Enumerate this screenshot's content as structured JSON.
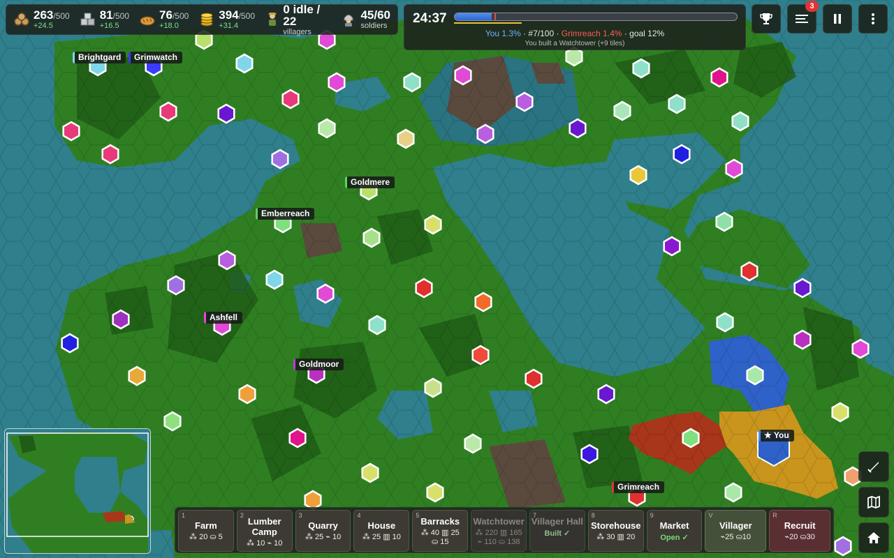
{
  "resources": [
    {
      "name": "wood",
      "icon": "logs-icon",
      "value": "263",
      "max": "/500",
      "rate": "+24.5"
    },
    {
      "name": "stone",
      "icon": "stone-blocks-icon",
      "value": "81",
      "max": "/500",
      "rate": "+16.5"
    },
    {
      "name": "food",
      "icon": "bread-icon",
      "value": "76",
      "max": "/500",
      "rate": "+18.0"
    },
    {
      "name": "gold",
      "icon": "coin-stack-icon",
      "value": "394",
      "max": "/500",
      "rate": "+31.4"
    }
  ],
  "villagers": {
    "value": "0 idle / 22",
    "label": "villagers"
  },
  "soldiers": {
    "value": "45/60",
    "label": "soldiers"
  },
  "timer": "24:37",
  "progress": {
    "you_fraction": 0.013,
    "rival_fraction": 0.014,
    "goal_fraction": 0.12
  },
  "standings": {
    "you": "You 1.3%",
    "rank": " · #7/100 · ",
    "rival": "Grimreach 1.4%",
    "goal": " · goal 12%"
  },
  "last_action": "You built a Watchtower (+9 tiles)",
  "notifications_count": "3",
  "cities": [
    {
      "name": "Brightgard",
      "color": "#7fd6e8"
    },
    {
      "name": "Grimwatch",
      "color": "#3b3bff"
    },
    {
      "name": "Goldmere",
      "color": "#57d957"
    },
    {
      "name": "Emberreach",
      "color": "#5fd15f"
    },
    {
      "name": "Ashfell",
      "color": "#e04ad6"
    },
    {
      "name": "Goldmoor",
      "color": "#b93ed0"
    },
    {
      "name": "Grimreach",
      "color": "#e23434"
    },
    {
      "name": "★ You",
      "color": "#4a8ef0"
    }
  ],
  "build": [
    {
      "key": "1",
      "name": "Farm",
      "cost": "⁂ 20 ⛀ 5"
    },
    {
      "key": "2",
      "name": "Lumber Camp",
      "cost": "⁂ 10 ⌁ 10"
    },
    {
      "key": "3",
      "name": "Quarry",
      "cost": "⁂ 25 ⌁ 10"
    },
    {
      "key": "4",
      "name": "House",
      "cost": "⁂ 25 ▥ 10"
    },
    {
      "key": "5",
      "name": "Barracks",
      "cost": "⁂ 40 ▥ 25",
      "cost2": "⛀ 15"
    },
    {
      "key": "6",
      "name": "Watchtower",
      "cost": "⁂ 220 ▥ 165",
      "cost2": "⌁ 110 ⛀ 138"
    },
    {
      "key": "7",
      "name": "Villager Hall",
      "status": "Built ✓"
    },
    {
      "key": "8",
      "name": "Storehouse",
      "cost": "⁂ 30 ▥ 20"
    },
    {
      "key": "9",
      "name": "Market",
      "status": "Open ✓"
    },
    {
      "key": "V",
      "name": "Villager",
      "cost": "⌁25 ⛀10"
    },
    {
      "key": "R",
      "name": "Recruit",
      "cost": "⌁20 ⛀30"
    }
  ],
  "colors": {
    "water": "#2f7f8c",
    "land": "#2e7d1f",
    "forest": "#1f5e17",
    "you": "#2f62c8",
    "rival": "#a8361a",
    "gold_territory": "#c9951d"
  }
}
